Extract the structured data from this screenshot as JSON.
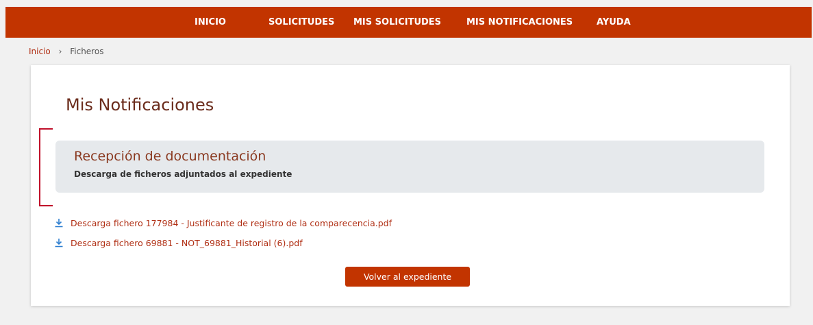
{
  "colors": {
    "brand": "#c23400",
    "link": "#b02f14",
    "title": "#6b2c1c",
    "panel_bg": "#e6e9ec"
  },
  "nav": {
    "inicio": "INICIO",
    "solicitudes": "SOLICITUDES",
    "mis_solicitudes": "MIS SOLICITUDES",
    "mis_notificaciones": "MIS NOTIFICACIONES",
    "ayuda": "AYUDA"
  },
  "breadcrumb": {
    "home": "Inicio",
    "separator": "›",
    "current": "Ficheros"
  },
  "main": {
    "title": "Mis Notificaciones",
    "panel": {
      "title": "Recepción de documentación",
      "subtitle": "Descarga de ficheros adjuntados al expediente"
    },
    "files": [
      {
        "label": "Descarga fichero 177984 - Justificante de registro de la comparecencia.pdf",
        "icon": "download-icon"
      },
      {
        "label": "Descarga fichero 69881 - NOT_69881_Historial (6).pdf",
        "icon": "download-icon"
      }
    ],
    "back_button": "Volver al expediente"
  }
}
